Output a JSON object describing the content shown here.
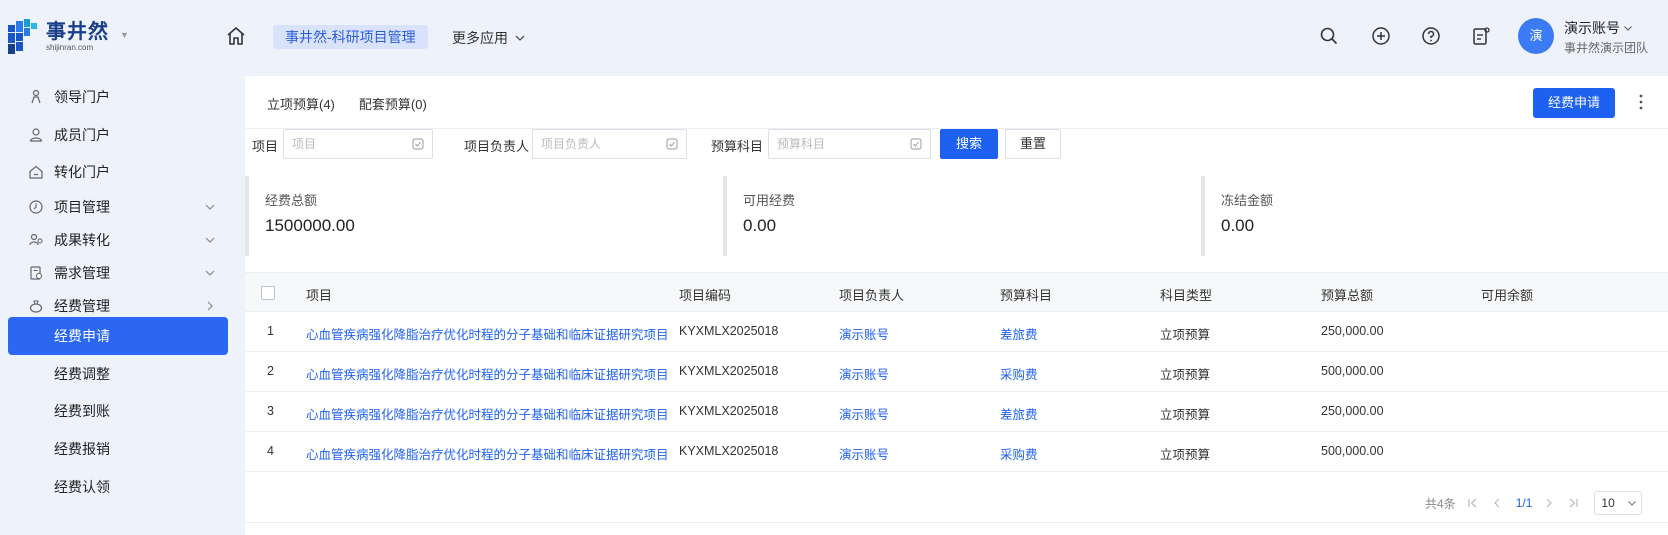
{
  "header": {
    "logo_cn": "事井然",
    "logo_en": "shijinran.com",
    "active_app": "事井然-科研项目管理",
    "more_apps": "更多应用",
    "avatar_text": "演",
    "user_name": "演示账号",
    "user_team": "事井然演示团队"
  },
  "sidebar": {
    "items": [
      {
        "label": "领导门户",
        "icon": "person-icon"
      },
      {
        "label": "成员门户",
        "icon": "user-icon"
      },
      {
        "label": "转化门户",
        "icon": "home-icon"
      },
      {
        "label": "项目管理",
        "icon": "clock-icon"
      },
      {
        "label": "成果转化",
        "icon": "people-icon"
      },
      {
        "label": "需求管理",
        "icon": "document-icon"
      },
      {
        "label": "经费管理",
        "icon": "money-icon"
      }
    ],
    "sub_items": [
      {
        "label": "经费申请"
      },
      {
        "label": "经费调整"
      },
      {
        "label": "经费到账"
      },
      {
        "label": "经费报销"
      },
      {
        "label": "经费认领"
      }
    ]
  },
  "main": {
    "tabs": [
      "立项预算(4)",
      "配套预算(0)"
    ],
    "apply_button": "经费申请",
    "filters": {
      "project_label": "项目",
      "project_placeholder": "项目",
      "leader_label": "项目负责人",
      "leader_placeholder": "项目负责人",
      "subject_label": "预算科目",
      "subject_placeholder": "预算科目",
      "search_label": "搜索",
      "reset_label": "重置"
    },
    "stats": [
      {
        "label": "经费总额",
        "value": "1500000.00"
      },
      {
        "label": "可用经费",
        "value": "0.00"
      },
      {
        "label": "冻结金额",
        "value": "0.00"
      }
    ],
    "table": {
      "headers": [
        "项目",
        "项目编码",
        "项目负责人",
        "预算科目",
        "科目类型",
        "预算总额",
        "可用余额"
      ],
      "rows": [
        {
          "no": "1",
          "project": "心血管疾病强化降脂治疗优化时程的分子基础和临床证据研究项目",
          "code": "KYXMLX2025018",
          "leader": "演示账号",
          "subject": "差旅费",
          "type": "立项预算",
          "total": "250,000.00",
          "balance": ""
        },
        {
          "no": "2",
          "project": "心血管疾病强化降脂治疗优化时程的分子基础和临床证据研究项目",
          "code": "KYXMLX2025018",
          "leader": "演示账号",
          "subject": "采购费",
          "type": "立项预算",
          "total": "500,000.00",
          "balance": ""
        },
        {
          "no": "3",
          "project": "心血管疾病强化降脂治疗优化时程的分子基础和临床证据研究项目",
          "code": "KYXMLX2025018",
          "leader": "演示账号",
          "subject": "差旅费",
          "type": "立项预算",
          "total": "250,000.00",
          "balance": ""
        },
        {
          "no": "4",
          "project": "心血管疾病强化降脂治疗优化时程的分子基础和临床证据研究项目",
          "code": "KYXMLX2025018",
          "leader": "演示账号",
          "subject": "采购费",
          "type": "立项预算",
          "total": "500,000.00",
          "balance": ""
        }
      ]
    },
    "pager": {
      "total_text": "共4条",
      "current": "1",
      "total_pages": "/1",
      "page_size": "10"
    }
  },
  "colors": {
    "primary": "#1e60f0",
    "sidebar_bg": "#eef2fa",
    "active_tab_bg": "#d8e3fb"
  }
}
